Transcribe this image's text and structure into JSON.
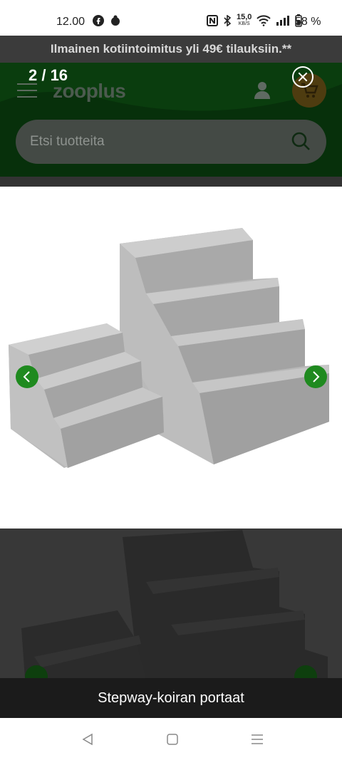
{
  "status_bar": {
    "time": "12.00",
    "network_speed_value": "15,0",
    "network_speed_unit": "KB/S",
    "battery_percent": "58 %"
  },
  "promo": {
    "text": "Ilmainen kotiintoimitus yli 49€ tilauksiin.**"
  },
  "header": {
    "logo": "zooplus",
    "search_placeholder": "Etsi tuotteita"
  },
  "gallery": {
    "counter": "2 / 16",
    "caption": "Stepway-koiran portaat"
  },
  "colors": {
    "brand_green": "#1f8a1f",
    "header_green": "#07300b"
  }
}
